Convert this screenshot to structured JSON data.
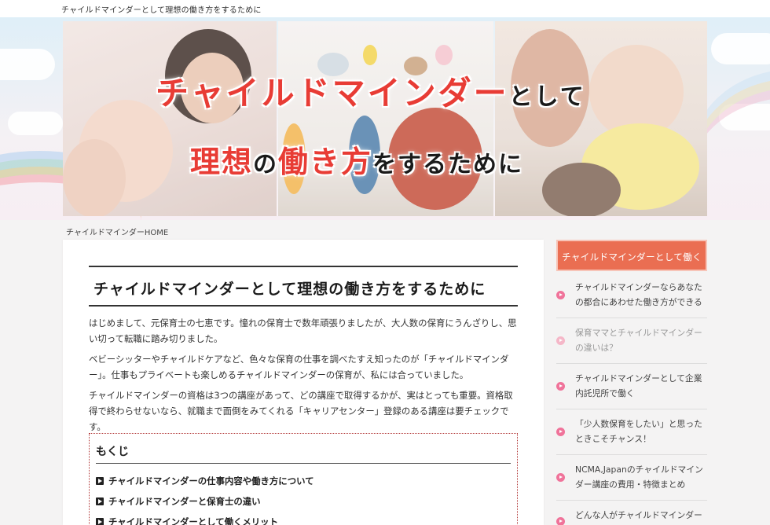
{
  "site": {
    "tagline": "チャイルドマインダーとして理想の働き方をするために"
  },
  "hero": {
    "line1_red": "チャイルドマインダー",
    "line1_black": "として",
    "line2_red1": "理想",
    "line2_black1": "の",
    "line2_red2": "働き方",
    "line2_black2": "をするために",
    "accent_red": "#e83c35"
  },
  "breadcrumb": {
    "home": "チャイルドマインダーHOME"
  },
  "article": {
    "title": "チャイルドマインダーとして理想の働き方をするために",
    "paragraphs": [
      "はじめまして、元保育士の七恵です。憧れの保育士で数年頑張りましたが、大人数の保育にうんざりし、思い切って転職に踏み切りました。",
      "ベビーシッターやチャイルドケアなど、色々な保育の仕事を調べたすえ知ったのが「チャイルドマインダー」。仕事もプライベートも楽しめるチャイルドマインダーの保育が、私には合っていました。",
      "チャイルドマインダーの資格は3つの講座があって、どの講座で取得するかが、実はとっても重要。資格取得で終わらせないなら、就職まで面倒をみてくれる「キャリアセンター」登録のある講座は要チェックです。"
    ],
    "toc": {
      "title": "もくじ",
      "items": [
        "チャイルドマインダーの仕事内容や働き方について",
        "チャイルドマインダーと保育士の違い",
        "チャイルドマインダーとして働くメリット"
      ]
    }
  },
  "sidebar": {
    "heading": "チャイルドマインダーとして働く",
    "heading_color": "#ea6e52",
    "items": [
      {
        "label": "チャイルドマインダーならあなたの都合にあわせた働き方ができる"
      },
      {
        "label": "保育ママとチャイルドマインダーの違いは？"
      },
      {
        "label": "チャイルドマインダーとして企業内託児所で働く"
      },
      {
        "label": "「少人数保育をしたい」と思ったときこそチャンス！"
      },
      {
        "label": "NCMA,Japanのチャイルドマインダー講座の費用・特徴まとめ"
      },
      {
        "label": "どんな人がチャイルドマインダーを"
      }
    ]
  }
}
